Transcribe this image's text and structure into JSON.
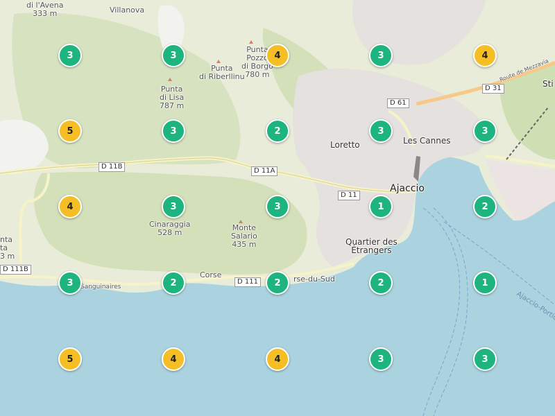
{
  "colors": {
    "land": "#e9ecd9",
    "forest": "#cfdfb4",
    "sea": "#aad3df",
    "urban": "#e5e2df",
    "cluster_green": "#1db47f",
    "cluster_yellow": "#f5be24",
    "road": "#f7f3c8"
  },
  "places": {
    "avena": "di l'Avena",
    "avena_alt": "333 m",
    "villanova": "Villanova",
    "punta_pozzo_1": "Punta",
    "punta_pozzo_2": "Pozzo",
    "punta_pozzo_3": "di Borgo",
    "punta_pozzo_alt": "780 m",
    "punta_riberllinu_1": "Punta",
    "punta_riberllinu_2": "di Riberllinu",
    "punta_lisa_1": "Punta",
    "punta_lisa_2": "di Lisa",
    "punta_lisa_alt": "787 m",
    "loretto": "Loretto",
    "les_cannes": "Les Cannes",
    "ajaccio": "Ajaccio",
    "quartier_1": "Quartier des",
    "quartier_2": "Étrangers",
    "cinaraggia_1": "Cinaraggia",
    "cinaraggia_alt": "528 m",
    "monte_salario_1": "Monte",
    "monte_salario_2": "Salario",
    "monte_salario_alt": "435 m",
    "sti": "Sti",
    "corse": "Corse",
    "sud": "rse-du-Sud",
    "sanguinaires": "Sanguinaires",
    "left_1": "nta",
    "left_2": "ta",
    "left_alt": "3 m"
  },
  "roads": {
    "d11b": "D 11B",
    "d11a": "D 11A",
    "d11": "D 11",
    "d61": "D 61",
    "d31": "D 31",
    "d111": "D 111",
    "d111b": "D 111B",
    "mezzavia": "Route de Mezzavia"
  },
  "sea_label": "Ajaccio-Portic",
  "clusters": [
    {
      "count": "3",
      "level": "green"
    },
    {
      "count": "3",
      "level": "green"
    },
    {
      "count": "4",
      "level": "yellow"
    },
    {
      "count": "3",
      "level": "green"
    },
    {
      "count": "4",
      "level": "yellow"
    },
    {
      "count": "5",
      "level": "yellow"
    },
    {
      "count": "3",
      "level": "green"
    },
    {
      "count": "2",
      "level": "green"
    },
    {
      "count": "3",
      "level": "green"
    },
    {
      "count": "3",
      "level": "green"
    },
    {
      "count": "4",
      "level": "yellow"
    },
    {
      "count": "3",
      "level": "green"
    },
    {
      "count": "3",
      "level": "green"
    },
    {
      "count": "1",
      "level": "green"
    },
    {
      "count": "2",
      "level": "green"
    },
    {
      "count": "3",
      "level": "green"
    },
    {
      "count": "2",
      "level": "green"
    },
    {
      "count": "2",
      "level": "green"
    },
    {
      "count": "2",
      "level": "green"
    },
    {
      "count": "1",
      "level": "green"
    },
    {
      "count": "5",
      "level": "yellow"
    },
    {
      "count": "4",
      "level": "yellow"
    },
    {
      "count": "4",
      "level": "yellow"
    },
    {
      "count": "3",
      "level": "green"
    },
    {
      "count": "3",
      "level": "green"
    }
  ]
}
